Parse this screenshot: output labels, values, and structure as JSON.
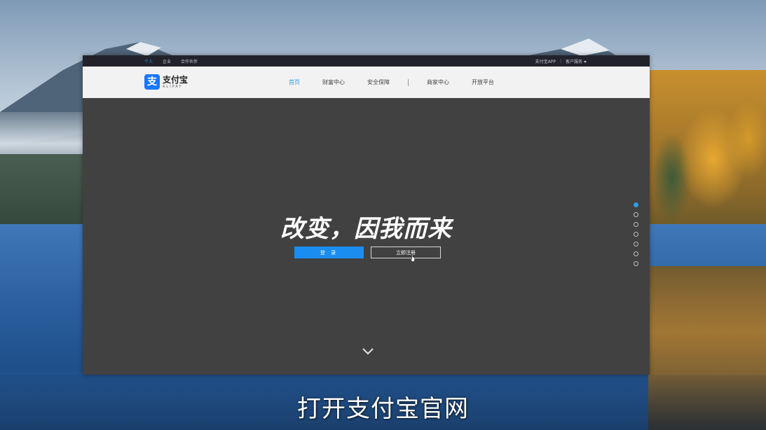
{
  "topbar": {
    "links": [
      "个人",
      "企业",
      "合作伙伴"
    ],
    "app_link": "支付宝APP",
    "service_link": "客户服务"
  },
  "logo": {
    "icon_glyph": "支",
    "name_cn": "支付宝",
    "name_en": "ALIPAY"
  },
  "nav": {
    "home": "首页",
    "wealth": "财富中心",
    "security": "安全保障",
    "merchant": "商家中心",
    "open_platform": "开放平台"
  },
  "hero": {
    "slogan": "改变，因我而来",
    "login_label": "登 录",
    "register_label": "立即注册"
  },
  "slides": {
    "count": 7,
    "active_index": 0
  },
  "subtitle": "打开支付宝官网",
  "colors": {
    "accent": "#1a8df0",
    "nav_active": "#2e9ee6",
    "hero_bg": "#414141",
    "topbar_bg": "#22232a"
  }
}
